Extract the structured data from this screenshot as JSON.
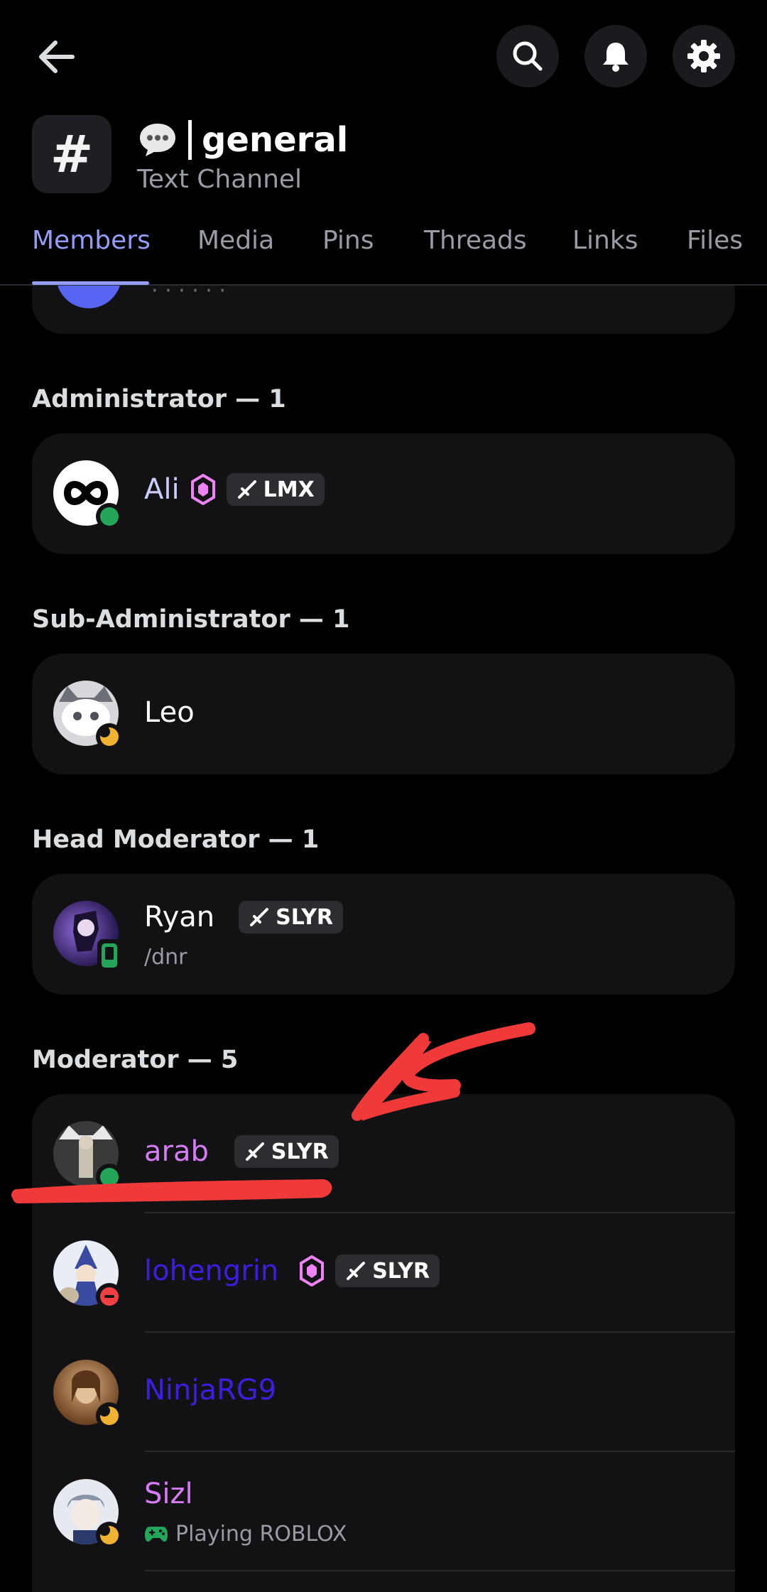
{
  "header": {
    "channel_name": "general",
    "channel_type": "Text Channel"
  },
  "tabs": [
    {
      "label": "Members",
      "active": true
    },
    {
      "label": "Media"
    },
    {
      "label": "Pins"
    },
    {
      "label": "Threads"
    },
    {
      "label": "Links"
    },
    {
      "label": "Files"
    }
  ],
  "sections": [
    {
      "title": "Administrator — 1",
      "members": [
        {
          "name": "Ali",
          "color": "#c9cdfb",
          "status": "online",
          "boost": true,
          "tag": "LMX"
        }
      ]
    },
    {
      "title": "Sub-Administrator — 1",
      "members": [
        {
          "name": "Leo",
          "color": "#ffffff",
          "status": "idle"
        }
      ]
    },
    {
      "title": "Head Moderator — 1",
      "members": [
        {
          "name": "Ryan",
          "color": "#ffffff",
          "status": "mobile",
          "tag": "SLYR",
          "subtext": "/dnr"
        }
      ]
    },
    {
      "title": "Moderator — 5",
      "members": [
        {
          "name": "arab",
          "color": "#d57cf5",
          "status": "online",
          "tag": "SLYR"
        },
        {
          "name": "lohengrin",
          "color": "#3b1fe0",
          "status": "dnd",
          "boost": true,
          "tag": "SLYR"
        },
        {
          "name": "NinjaRG9",
          "color": "#3b1fe0",
          "status": "idle"
        },
        {
          "name": "Sizl",
          "color": "#d57cf5",
          "status": "idle",
          "subtext": "Playing ROBLOX"
        }
      ]
    }
  ],
  "icons": {
    "back": "arrow-left-icon",
    "search": "search-icon",
    "bell": "bell-icon",
    "gear": "gear-icon",
    "speech": "speech-bubble-icon",
    "boost": "server-boost-icon",
    "sword": "sword-icon",
    "controller": "game-controller-icon"
  },
  "colors": {
    "accent": "#949cf7",
    "online": "#23a55a",
    "idle": "#f0b232",
    "dnd": "#f23f43",
    "annotation": "#f03a3a"
  }
}
